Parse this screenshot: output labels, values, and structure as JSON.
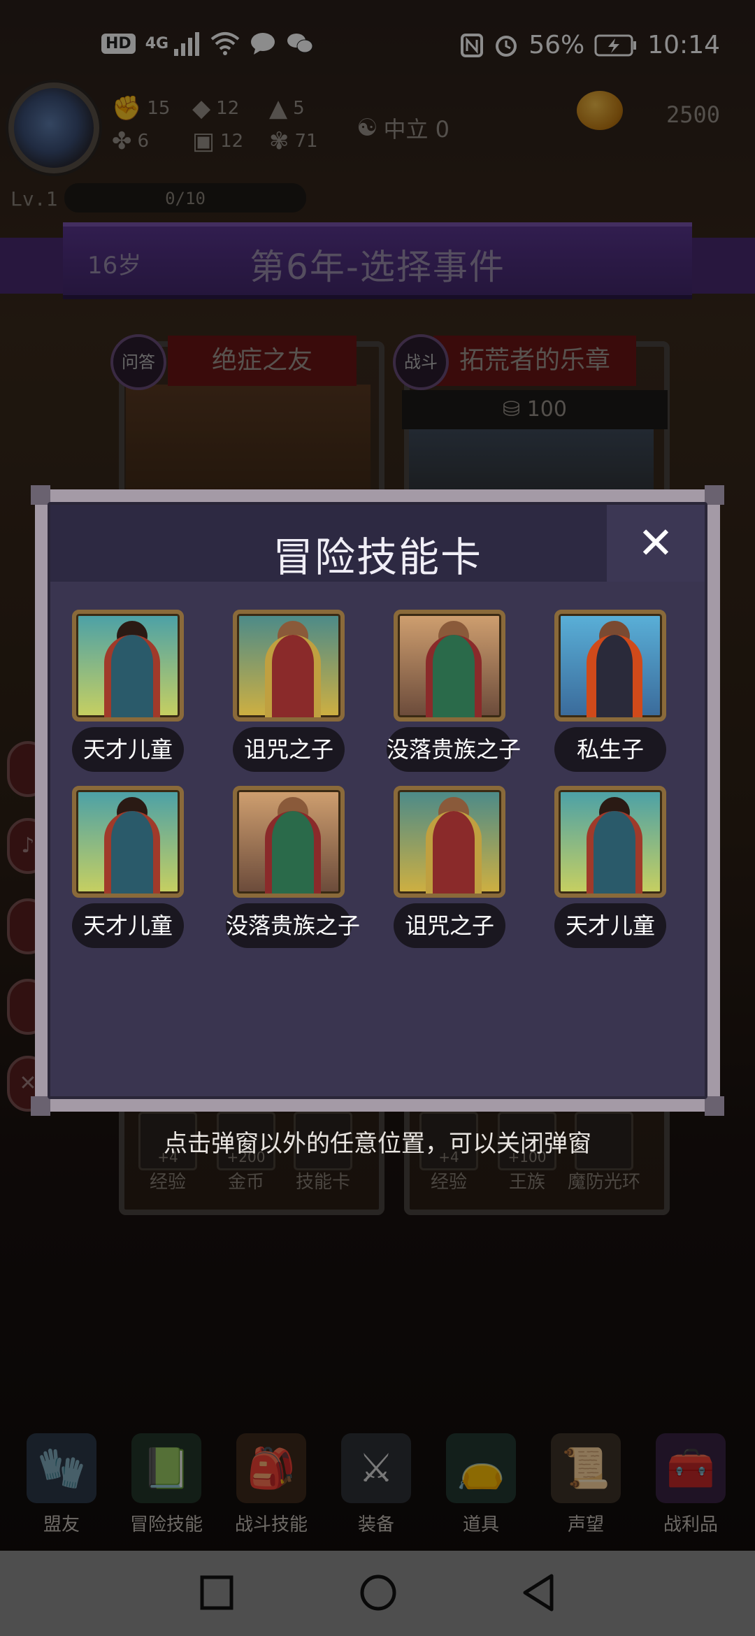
{
  "status_bar": {
    "left_badge": "HD",
    "network": "4G",
    "battery": "56%",
    "time": "10:14"
  },
  "player": {
    "stats": [
      {
        "icon": "fist-icon",
        "value": "15"
      },
      {
        "icon": "clover-icon",
        "value": "6"
      },
      {
        "icon": "eraser-icon",
        "value": "12"
      },
      {
        "icon": "armor-icon",
        "value": "12"
      },
      {
        "icon": "wizard-hat-icon",
        "value": "5"
      },
      {
        "icon": "plant-icon",
        "value": "71"
      }
    ],
    "alignment": "中立 0",
    "coins": "2500",
    "level": "Lv.1",
    "xp": "0/10",
    "xp_fraction": 0
  },
  "banner": {
    "age": "16岁",
    "title": "第6年-选择事件"
  },
  "event_cards": [
    {
      "tag": "问答",
      "title": "绝症之友"
    },
    {
      "tag": "战斗",
      "title": "拓荒者的乐章",
      "cost": "100"
    }
  ],
  "rewards": {
    "left": [
      {
        "amount": "+4",
        "label": "经验"
      },
      {
        "amount": "+200",
        "label": "金币"
      },
      {
        "amount": "",
        "label": "技能卡"
      }
    ],
    "right": [
      {
        "amount": "+4",
        "label": "经验"
      },
      {
        "amount": "+100",
        "label": "王族"
      },
      {
        "amount": "",
        "label": "魔防光环"
      }
    ]
  },
  "modal": {
    "title": "冒险技能卡",
    "close_icon": "close-icon",
    "skills": [
      {
        "name": "天才儿童",
        "portrait": "back-view-boy"
      },
      {
        "name": "诅咒之子",
        "portrait": "robed-boy"
      },
      {
        "name": "没落贵族之子",
        "portrait": "green-cloak-boy"
      },
      {
        "name": "私生子",
        "portrait": "red-cloak-boy"
      },
      {
        "name": "天才儿童",
        "portrait": "back-view-boy"
      },
      {
        "name": "没落贵族之子",
        "portrait": "green-cloak-boy"
      },
      {
        "name": "诅咒之子",
        "portrait": "robed-boy"
      },
      {
        "name": "天才儿童",
        "portrait": "back-view-boy"
      }
    ],
    "hint": "点击弹窗以外的任意位置，可以关闭弹窗"
  },
  "bottom_nav": [
    {
      "label": "盟友",
      "icon": "gauntlet-icon",
      "color": "#5a6a8a"
    },
    {
      "label": "冒险技能",
      "icon": "book-icon",
      "color": "#3a6a4a"
    },
    {
      "label": "战斗技能",
      "icon": "backpack-icon",
      "color": "#8a5a3a"
    },
    {
      "label": "装备",
      "icon": "crossed-swords-icon",
      "color": "#5a6070"
    },
    {
      "label": "道具",
      "icon": "pouch-icon",
      "color": "#3a6a5a"
    },
    {
      "label": "声望",
      "icon": "scroll-icon",
      "color": "#c0a070"
    },
    {
      "label": "战利品",
      "icon": "treasure-chest-icon",
      "color": "#7a4a8a"
    }
  ]
}
